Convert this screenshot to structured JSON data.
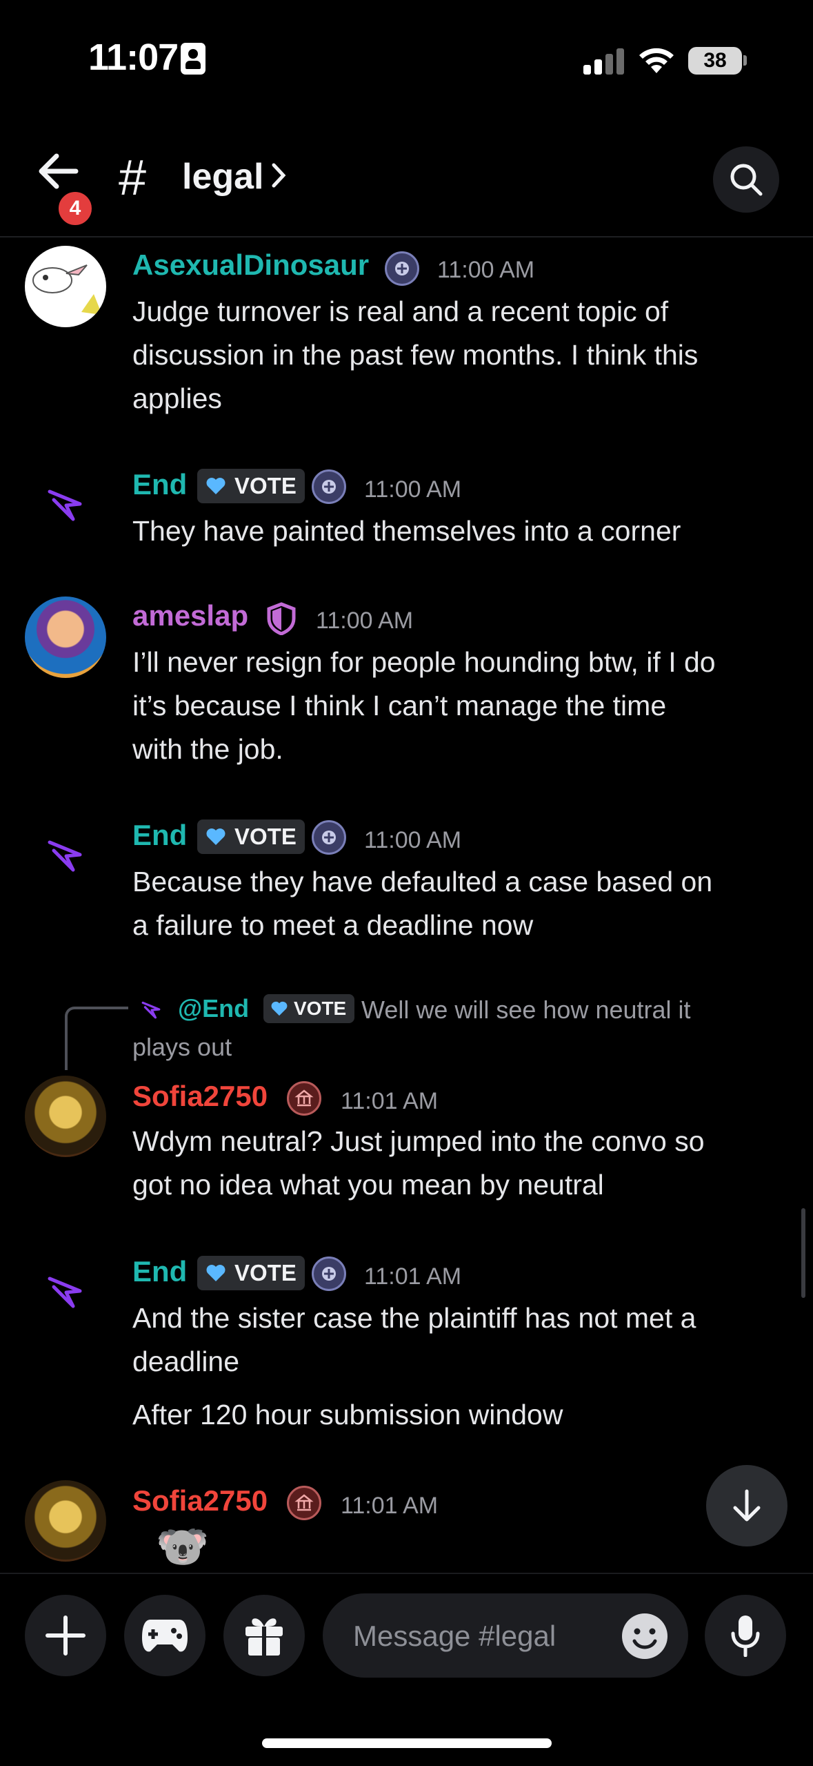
{
  "status_bar": {
    "time": "11:07",
    "battery": "38"
  },
  "header": {
    "channel_hash": "#",
    "channel_name": "legal",
    "back_badge": "4"
  },
  "colors": {
    "teal": "#1fb8b0",
    "purple_user": "#c26bd6",
    "red_user": "#f0453b",
    "bg": "#000000",
    "surface": "#1c1d21",
    "tag_bg": "#2b2d31",
    "heart": "#5ab8ff"
  },
  "messages": [
    {
      "username": "AsexualDinosaur",
      "time": "11:00 AM",
      "lines": [
        "Judge turnover is real and a recent topic of",
        "discussion in the past few months. I think this",
        "applies"
      ]
    },
    {
      "username": "End",
      "tag": "VOTE",
      "time": "11:00 AM",
      "lines": [
        "They have painted themselves into a corner"
      ]
    },
    {
      "username": "ameslap",
      "time": "11:00 AM",
      "lines": [
        "I’ll never resign for people hounding btw, if I do",
        "it’s because I think I can’t manage the time",
        "with the job."
      ]
    },
    {
      "username": "End",
      "tag": "VOTE",
      "time": "11:00 AM",
      "lines": [
        "Because they have defaulted a case based on",
        "a failure to meet a deadline now"
      ]
    },
    {
      "username": "Sofia2750",
      "time": "11:01 AM",
      "reply": {
        "mention": "@End",
        "tag": "VOTE",
        "text_1": "Well we will see how neutral it",
        "text_2": "plays out"
      },
      "lines": [
        "Wdym neutral? Just jumped into the convo so",
        "got no idea what you mean by neutral"
      ]
    },
    {
      "username": "End",
      "tag": "VOTE",
      "time": "11:01 AM",
      "lines": [
        "And the sister case the plaintiff has not met a",
        "deadline"
      ],
      "extra": "After 120 hour submission window"
    },
    {
      "username": "Sofia2750",
      "time": "11:01 AM",
      "emoji": "🐨"
    }
  ],
  "composer": {
    "placeholder": "Message #legal"
  }
}
